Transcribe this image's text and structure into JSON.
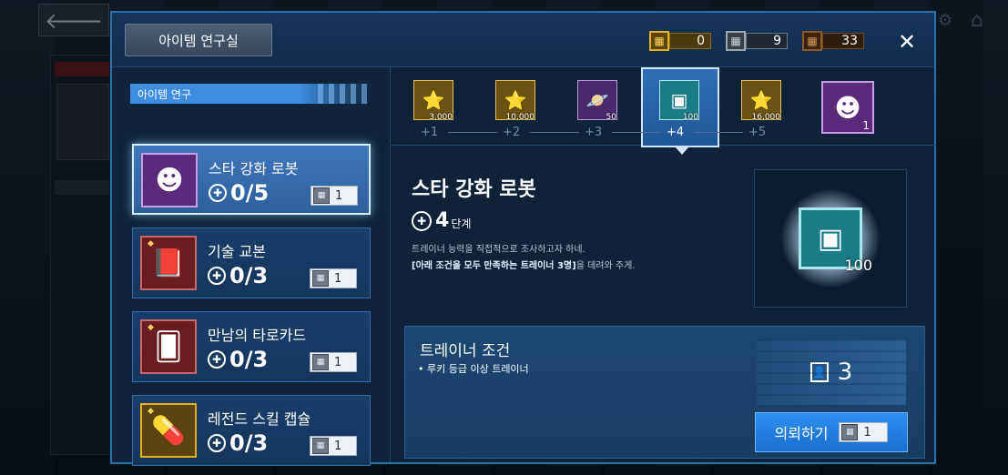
{
  "colors": {
    "accent": "#2e8fef",
    "panel": "#0f2238",
    "gold": "#e3b21b",
    "silver": "#9da6af",
    "bronze": "#8b5a2b",
    "active_border": "#d6ecff"
  },
  "modal": {
    "title": "아이템 연구실",
    "currencies": [
      {
        "icon": "gold-ticket-icon",
        "value": "0"
      },
      {
        "icon": "silver-ticket-icon",
        "value": "9"
      },
      {
        "icon": "bronze-ticket-icon",
        "value": "33"
      }
    ],
    "close_icon": "close-icon"
  },
  "left": {
    "section_label": "아이템 연구",
    "quests": [
      {
        "name": "스타 강화 로봇",
        "progress": "0/5",
        "cost": "1",
        "icon": "robot-head-icon",
        "active": true
      },
      {
        "name": "기술 교본",
        "progress": "0/3",
        "cost": "1",
        "icon": "book-icon",
        "active": false
      },
      {
        "name": "만남의 타로카드",
        "progress": "0/3",
        "cost": "1",
        "icon": "tarot-card-icon",
        "active": false
      },
      {
        "name": "레전드 스킬 캡슐",
        "progress": "0/3",
        "cost": "1",
        "icon": "capsule-icon",
        "active": false
      }
    ]
  },
  "steps": [
    {
      "label": "+1",
      "amount": "3,000",
      "icon": "gold-coin-icon"
    },
    {
      "label": "+2",
      "amount": "10,000",
      "icon": "gold-coin-icon"
    },
    {
      "label": "+3",
      "amount": "50",
      "icon": "purple-orb-icon"
    },
    {
      "label": "+4",
      "amount": "100",
      "icon": "teal-card-icon"
    },
    {
      "label": "+5",
      "amount": "16,000",
      "icon": "gold-coin-icon"
    }
  ],
  "final_reward": {
    "amount": "1",
    "icon": "robot-head-icon"
  },
  "detail": {
    "title": "스타 강화 로봇",
    "stage": "4",
    "stage_unit": "단계",
    "desc_line1": "트레이너 능력을 직접적으로 조사하고자 하네.",
    "desc_highlight": "[아래 조건을 모두 만족하는 트레이너 3명]",
    "desc_rest": "을 데려와 주게.",
    "reward_amount": "100"
  },
  "condition": {
    "title": "트레이너 조건",
    "item": "• 루키 등급 이상 트레이너",
    "count": "3",
    "request_label": "의뢰하기",
    "request_cost": "1"
  }
}
